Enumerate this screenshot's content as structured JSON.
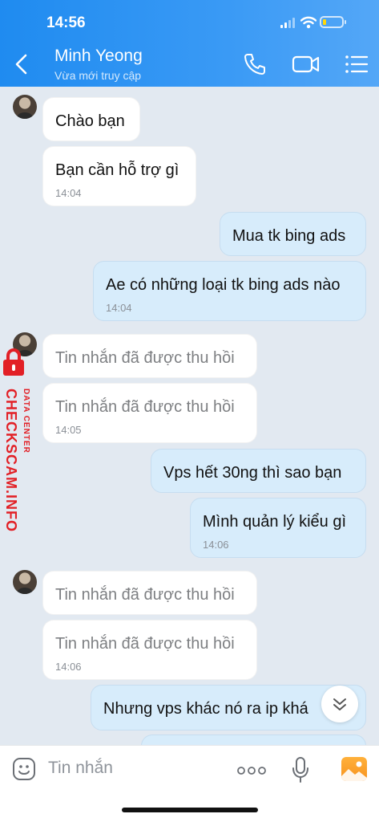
{
  "status_bar": {
    "time": "14:56"
  },
  "header": {
    "contact_name": "Minh Yeong",
    "contact_status": "Vừa mới truy cập",
    "icons": [
      "back-icon",
      "phone-call-icon",
      "video-call-icon",
      "menu-list-icon"
    ]
  },
  "messages": [
    {
      "side": "incoming",
      "text": "Chào bạn",
      "time": ""
    },
    {
      "side": "incoming",
      "text": "Bạn cần hỗ trợ gì",
      "time": "14:04"
    },
    {
      "side": "outgoing",
      "text": "Mua tk bing ads",
      "time": ""
    },
    {
      "side": "outgoing",
      "text": "Ae có những loại tk bing ads nào",
      "time": "14:04"
    },
    {
      "side": "incoming",
      "text": "Tin nhắn đã được thu hồi",
      "time": "",
      "recalled": true
    },
    {
      "side": "incoming",
      "text": "Tin nhắn đã được thu hồi",
      "time": "14:05",
      "recalled": true
    },
    {
      "side": "outgoing",
      "text": "Vps hết 30ng thì sao bạn",
      "time": ""
    },
    {
      "side": "outgoing",
      "text": "Mình quản lý kiểu gì",
      "time": "14:06"
    },
    {
      "side": "incoming",
      "text": "Tin nhắn đã được thu hồi",
      "time": "",
      "recalled": true
    },
    {
      "side": "incoming",
      "text": "Tin nhắn đã được thu hồi",
      "time": "14:06",
      "recalled": true
    },
    {
      "side": "outgoing",
      "text": "Nhưng vps khác nó ra ip khá",
      "time": ""
    }
  ],
  "watermark": {
    "main": "CHECKSCAM.INFO",
    "sub": "DATA CENTER",
    "color": "#e22026"
  },
  "composer": {
    "placeholder": "Tin nhắn"
  },
  "colors": {
    "header": "#2a93f3",
    "outgoing_bubble": "#d7ecfb",
    "incoming_bubble": "#ffffff",
    "background": "#e2e9f1"
  }
}
